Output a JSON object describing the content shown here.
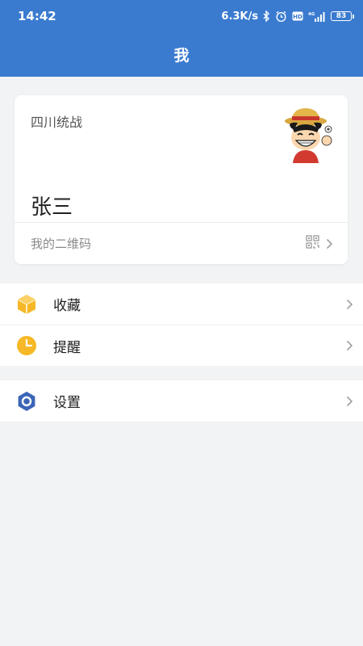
{
  "status_bar": {
    "time": "14:42",
    "speed": "6.3K/s",
    "battery": "83",
    "icons": [
      "bluetooth-icon",
      "alarm-icon",
      "hd-icon",
      "signal-4g-icon",
      "battery-icon"
    ]
  },
  "header": {
    "title": "我"
  },
  "profile": {
    "org": "四川统战",
    "name": "张三",
    "qr_label": "我的二维码",
    "avatar_icon": "avatar-cartoon"
  },
  "menu": {
    "group1": [
      {
        "label": "收藏",
        "icon": "box-icon",
        "color": "#f6b826"
      },
      {
        "label": "提醒",
        "icon": "clock-icon",
        "color": "#f6b826"
      }
    ],
    "group2": [
      {
        "label": "设置",
        "icon": "settings-icon",
        "color": "#3c65b8"
      }
    ]
  },
  "colors": {
    "primary": "#3a7bd0",
    "background": "#f2f3f5"
  }
}
